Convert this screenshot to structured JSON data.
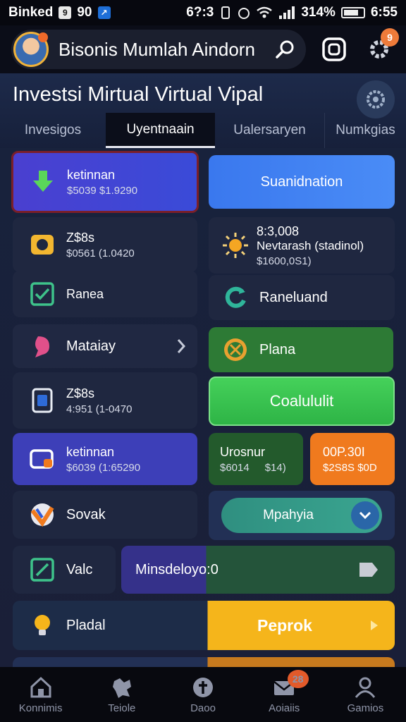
{
  "status_bar": {
    "carrier": "Binked",
    "left_a": "9",
    "left_b": "90",
    "time_left": "6?:3",
    "battery_pct": "314%",
    "time_right": "6:55"
  },
  "app_bar": {
    "title": "Bisonis Mumlah Aindorn",
    "settings_badge": "9"
  },
  "header": {
    "title": "Investsi Mirtual Virtual Vipal"
  },
  "tabs": [
    "Invesigos",
    "Uyentnaain",
    "Ualersaryen",
    "Numkgias"
  ],
  "cards": {
    "c1": {
      "title": "ketinnan",
      "subtitle": "$5039 $1.9290"
    },
    "c2": {
      "label": "Suanidnation"
    },
    "c3": {
      "title": "Z$8s",
      "subtitle": "$0561 (1.0420"
    },
    "c4": {
      "title": "8:3,008",
      "line2": "Nevtarash (stadinol)",
      "line3": "$1600,0S1)"
    },
    "c5": {
      "title": "Ranea"
    },
    "c6": {
      "title": "Raneluand"
    },
    "c7": {
      "title": "Mataiay"
    },
    "c8": {
      "title": "Plana"
    },
    "c9": {
      "title": "Z$8s",
      "subtitle": "4:951 (1-0470"
    },
    "c10": {
      "label": "Coalululit"
    },
    "c11": {
      "title": "ketinnan",
      "subtitle": "$6039 (1:65290"
    },
    "c12": {
      "title": "Urosnur",
      "v1": "$6014",
      "v2": "$14)"
    },
    "c13": {
      "title": "00P.30I",
      "subtitle": "$2S8S $0D"
    },
    "c14": {
      "title": "Sovak"
    },
    "c15": {
      "label": "Mpahyia"
    },
    "c16": {
      "title": "Valc"
    },
    "c17": {
      "title": "Minsdeloyo:0"
    },
    "c18": {
      "title": "Pladal"
    },
    "c19": {
      "label": "Peprok"
    }
  },
  "bottom_nav": [
    {
      "label": "Konnimis",
      "icon": "home-icon"
    },
    {
      "label": "Teiole",
      "icon": "puzzle-icon"
    },
    {
      "label": "Daoo",
      "icon": "compass-icon"
    },
    {
      "label": "Aoiaiis",
      "icon": "mail-icon",
      "badge": "28"
    },
    {
      "label": "Gamios",
      "icon": "person-icon"
    }
  ],
  "colors": {
    "blue_button": "#3d7ef0",
    "green_button": "#2fbf47",
    "orange_card": "#f07a1e",
    "yellow_button": "#f5b51b",
    "purple_card": "#3d3fb8"
  }
}
